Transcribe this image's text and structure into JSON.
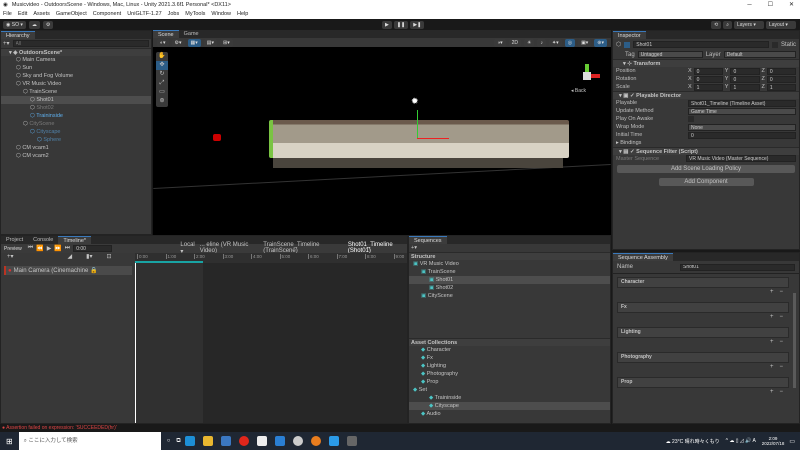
{
  "window": {
    "title": "Musicvideo - OutdoorsScene - Windows, Mac, Linux - Unity 2021.3.6f1 Personal* <DX11>"
  },
  "menu": [
    "File",
    "Edit",
    "Assets",
    "GameObject",
    "Component",
    "UniGLTF-1.27",
    "Jobs",
    "MyTools",
    "Window",
    "Help"
  ],
  "toolbar": {
    "account": "SO",
    "layers": "Layers",
    "layout": "Layout"
  },
  "hierarchy": {
    "tab": "Hierarchy",
    "search_placeholder": "All",
    "items": [
      {
        "label": "OutdoorsScene*",
        "indent": 0,
        "style": "scene"
      },
      {
        "label": "Main Camera",
        "indent": 1,
        "style": "normal"
      },
      {
        "label": "Sun",
        "indent": 1,
        "style": "normal"
      },
      {
        "label": "Sky and Fog Volume",
        "indent": 1,
        "style": "normal"
      },
      {
        "label": "VR Music Video",
        "indent": 1,
        "style": "normal"
      },
      {
        "label": "TrainScene",
        "indent": 2,
        "style": "normal"
      },
      {
        "label": "Shot01",
        "indent": 3,
        "style": "selected"
      },
      {
        "label": "Shot02",
        "indent": 3,
        "style": "dim"
      },
      {
        "label": "Traininside",
        "indent": 3,
        "style": "blue"
      },
      {
        "label": "CityScene",
        "indent": 2,
        "style": "dim"
      },
      {
        "label": "Cityscape",
        "indent": 3,
        "style": "dimblue"
      },
      {
        "label": "Sphere",
        "indent": 4,
        "style": "dimblue"
      },
      {
        "label": "CM vcam1",
        "indent": 1,
        "style": "normal"
      },
      {
        "label": "CM vcam2",
        "indent": 1,
        "style": "normal"
      }
    ]
  },
  "scene": {
    "tabs": [
      "Scene",
      "Game"
    ],
    "gizmo_label": "Back"
  },
  "inspector": {
    "tab": "Inspector",
    "object_name": "Shot01",
    "static_label": "Static",
    "tag_label": "Tag",
    "tag": "Untagged",
    "layer_label": "Layer",
    "layer": "Default",
    "transform": {
      "title": "Transform",
      "rows": [
        {
          "label": "Position",
          "x": "0",
          "y": "0",
          "z": "0"
        },
        {
          "label": "Rotation",
          "x": "0",
          "y": "0",
          "z": "0"
        },
        {
          "label": "Scale",
          "x": "1",
          "y": "1",
          "z": "1"
        }
      ]
    },
    "director": {
      "title": "Playable Director",
      "rows": [
        {
          "label": "Playable",
          "value": "Shot01_Timeline (Timeline Asset)"
        },
        {
          "label": "Update Method",
          "value": "Game Time"
        },
        {
          "label": "Play On Awake",
          "value": ""
        },
        {
          "label": "Wrap Mode",
          "value": "None"
        },
        {
          "label": "Initial Time",
          "value": "0"
        }
      ],
      "bindings": "Bindings"
    },
    "filter": {
      "title": "Sequence Filter (Script)",
      "master_label": "Master Sequence",
      "master_value": "VR Music Video (Master Sequence)",
      "policy_button": "Add Scene Loading Policy"
    },
    "add_component": "Add Component"
  },
  "bottom_tabs": [
    "Project",
    "Console",
    "Timeline*"
  ],
  "timeline": {
    "preview": "Preview",
    "time": "0:00",
    "mode": "Local",
    "breadcrumbs": [
      "... eline (VR Music Video)",
      "TrainScene_Timeline (TrainScene)",
      "Shot01_Timeline (Shot01)"
    ],
    "ticks": [
      "0:00",
      "1:00",
      "2:00",
      "3:00",
      "4:00",
      "5:00",
      "6:00",
      "7:00",
      "8:00",
      "9:00"
    ],
    "track": "Main Camera (Cinemachine"
  },
  "sequences": {
    "tab": "Sequences",
    "structure_title": "Structure",
    "structure": [
      {
        "label": "VR Music Video",
        "indent": 0
      },
      {
        "label": "TrainScene",
        "indent": 1
      },
      {
        "label": "Shot01",
        "indent": 2,
        "selected": true
      },
      {
        "label": "Shot02",
        "indent": 2
      },
      {
        "label": "CityScene",
        "indent": 1
      }
    ],
    "collections_title": "Asset Collections",
    "collections": [
      {
        "label": "Character",
        "indent": 1
      },
      {
        "label": "Fx",
        "indent": 1
      },
      {
        "label": "Lighting",
        "indent": 1
      },
      {
        "label": "Photography",
        "indent": 1
      },
      {
        "label": "Prop",
        "indent": 1
      },
      {
        "label": "Set",
        "indent": 0
      },
      {
        "label": "Traininside",
        "indent": 2
      },
      {
        "label": "Cityscape",
        "indent": 2,
        "selected": true
      },
      {
        "label": "Audio",
        "indent": 1
      }
    ]
  },
  "assembly": {
    "tab": "Sequence Assembly",
    "name_label": "Name",
    "name_value": "Shot01",
    "groups": [
      "Character",
      "Fx",
      "Lighting",
      "Photography",
      "Prop"
    ]
  },
  "status": {
    "error": "Assertion failed on expression: 'SUCCEEDED(hr)'"
  },
  "taskbar": {
    "search_placeholder": "ここに入力して検索",
    "weather": "23°C  晴れ時々くもり",
    "time": "2:09",
    "date": "2022/07/18"
  }
}
